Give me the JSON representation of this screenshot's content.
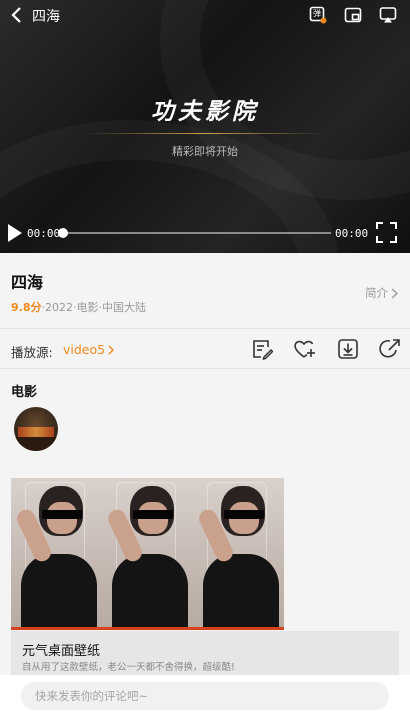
{
  "player": {
    "title": "四海",
    "brand": "功夫影院",
    "subtitle": "精彩即将开始",
    "current_time": "00:00",
    "duration": "00:00",
    "progress": 0,
    "danmaku_badge": "弹"
  },
  "movie": {
    "title": "四海",
    "score": "9.8分",
    "meta": "·2022·电影·中国大陆",
    "intro_label": "简介"
  },
  "source": {
    "label": "播放源:",
    "value": "video5"
  },
  "section": {
    "title": "电影"
  },
  "ad": {
    "title": "元气桌面壁纸",
    "description": "自从用了这款壁纸，老公一天都不舍得换，超级酷!"
  },
  "comment": {
    "placeholder": "快来发表你的评论吧~"
  },
  "colors": {
    "accent": "#f08a1c",
    "ad_progress": "#d8431f"
  }
}
